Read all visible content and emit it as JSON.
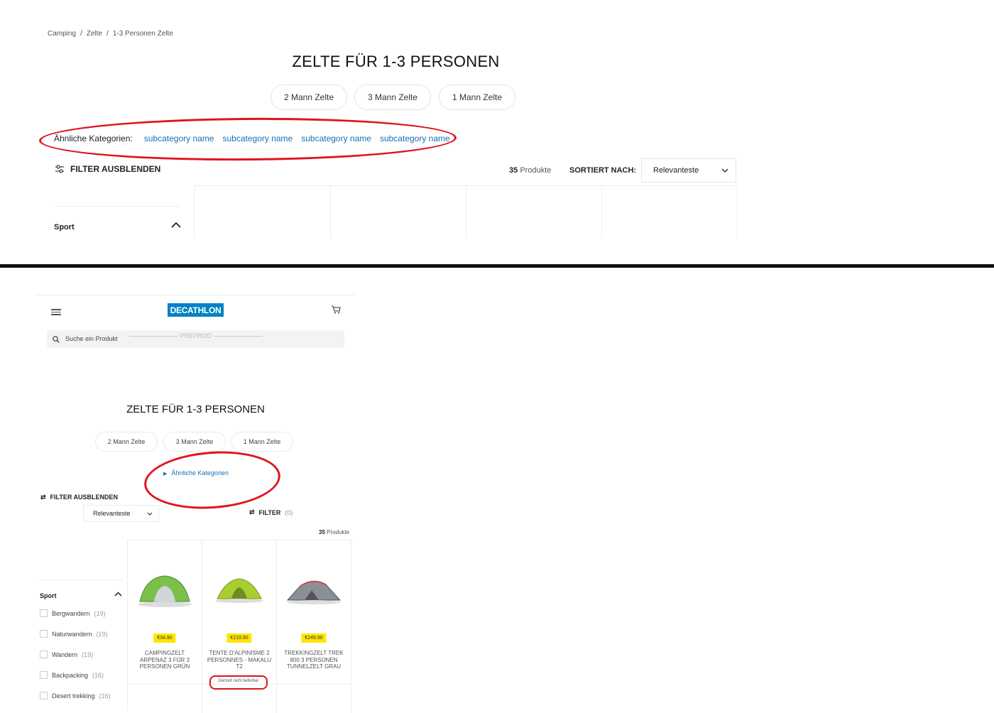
{
  "desktop": {
    "breadcrumb": [
      "Camping",
      "Zelte",
      "1-3 Personen Zelte"
    ],
    "breadcrumb_sep": "/",
    "title": "ZELTE FÜR 1-3 PERSONEN",
    "pills": [
      "2 Mann Zelte",
      "3 Mann Zelte",
      "1 Mann Zelte"
    ],
    "similar_label": "Ähnliche Kategorien:",
    "similar_links": [
      "subcategory name",
      "subcategory name",
      "subcategory name",
      "subcategory name"
    ],
    "filter_toggle": "FILTER AUSBLENDEN",
    "count_num": "35",
    "count_text": "Produkte",
    "sort_label": "SORTIERT NACH:",
    "sort_value": "Relevanteste",
    "sidebar_heading": "Sport"
  },
  "mobile": {
    "logo": "DECATHLON",
    "search_placeholder": "Suche ein Produkt",
    "preprod": "PREPROD",
    "title": "ZELTE FÜR 1-3 PERSONEN",
    "pills": [
      "2 Mann Zelte",
      "3 Mann Zelte",
      "1 Mann Zelte"
    ],
    "similar": "Ähnliche Kategorien",
    "filter_toggle": "FILTER AUSBLENDEN",
    "sort_value": "Relevanteste",
    "filter": "FILTER",
    "filter_count": "(0)",
    "count_num": "35",
    "count_text": "Produkte",
    "sidebar_heading": "Sport",
    "sidebar_options": [
      {
        "label": "Bergwandern",
        "count": "(19)"
      },
      {
        "label": "Naturwandern",
        "count": "(19)"
      },
      {
        "label": "Wandern",
        "count": "(19)"
      },
      {
        "label": "Backpacking",
        "count": "(16)"
      },
      {
        "label": "Desert trekking",
        "count": "(16)"
      }
    ],
    "products": [
      {
        "price": "€34.90",
        "name": "CAMPINGZELT ARPENAZ 3 FÜR 3 PERSONEN GRÜN",
        "tent_color": "#7cc04b",
        "unavailable": ""
      },
      {
        "price": "€219.90",
        "name": "TENTE D'ALPINISME 2 PERSONNES - MAKALU T2",
        "tent_color": "#a8cf2e",
        "unavailable": "Derzeit nicht lieferbar"
      },
      {
        "price": "€249.90",
        "name": "TREKKINGZELT TREK 900 3 PERSONEN TUNNELZELT GRAU",
        "tent_color": "#8a8f98",
        "unavailable": ""
      }
    ]
  },
  "colors": {
    "accent": "#0082c3",
    "annotation": "#e0141d",
    "price_bg": "#ffe500",
    "link": "#1a6fb0"
  }
}
